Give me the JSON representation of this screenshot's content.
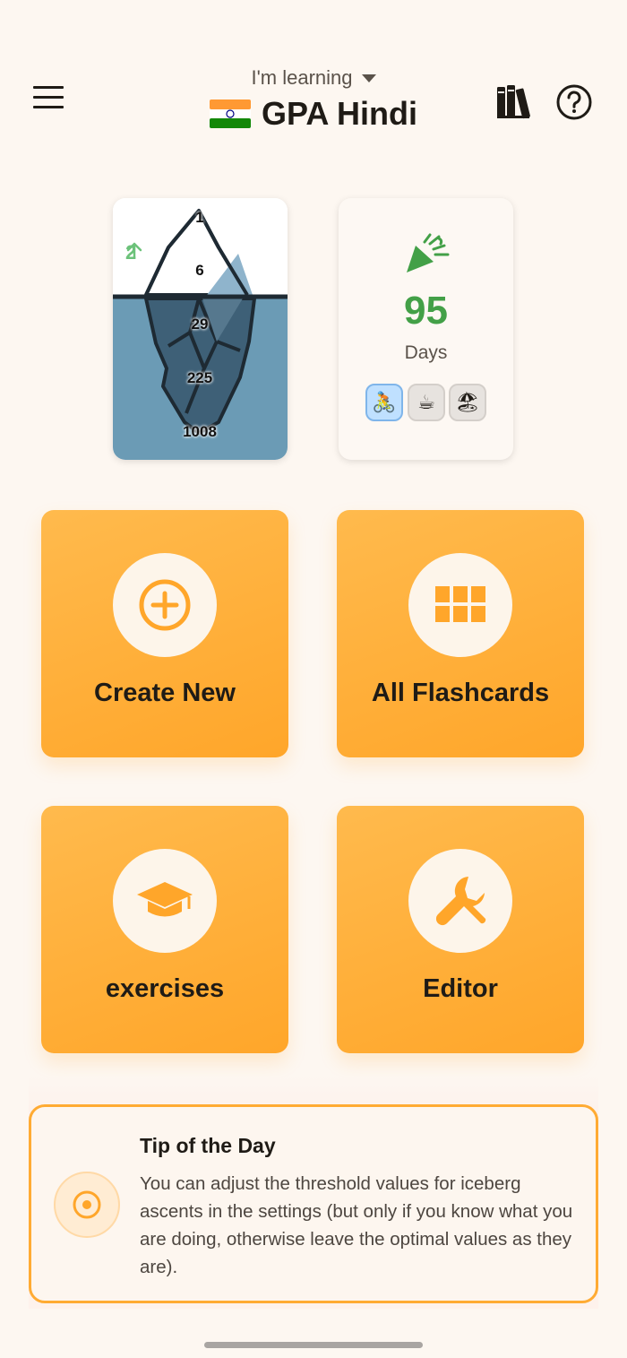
{
  "header": {
    "subtitle": "I'm learning",
    "title": "GPA Hindi",
    "flag": "india-flag-icon",
    "icons": {
      "menu": "menu-icon",
      "library": "books-icon",
      "help": "help-icon"
    }
  },
  "iceberg": {
    "ascent": "2",
    "levels": [
      "1",
      "6",
      "29",
      "225",
      "1008"
    ]
  },
  "streak": {
    "count": "95",
    "label": "Days",
    "badges": [
      {
        "emoji": "🚴",
        "active": true
      },
      {
        "emoji": "☕",
        "active": false
      },
      {
        "emoji": "🏖",
        "active": false
      }
    ]
  },
  "tiles": [
    {
      "label": "Create New",
      "icon": "add-circle-icon"
    },
    {
      "label": "All Flashcards",
      "icon": "grid-icon"
    },
    {
      "label": "exercises",
      "icon": "graduation-cap-icon"
    },
    {
      "label": "Editor",
      "icon": "wrench-icon"
    }
  ],
  "tip": {
    "title": "Tip of the Day",
    "text": "You can adjust the threshold values for iceberg ascents in the settings (but only if you know what you are doing, otherwise leave the optimal values as they are).",
    "icon": "target-icon"
  },
  "colors": {
    "accent": "#ffa62a",
    "streak_green": "#43a047",
    "ascent_green": "#6cc27a",
    "water": "#6b9bb5",
    "background": "#fdf7f1"
  }
}
